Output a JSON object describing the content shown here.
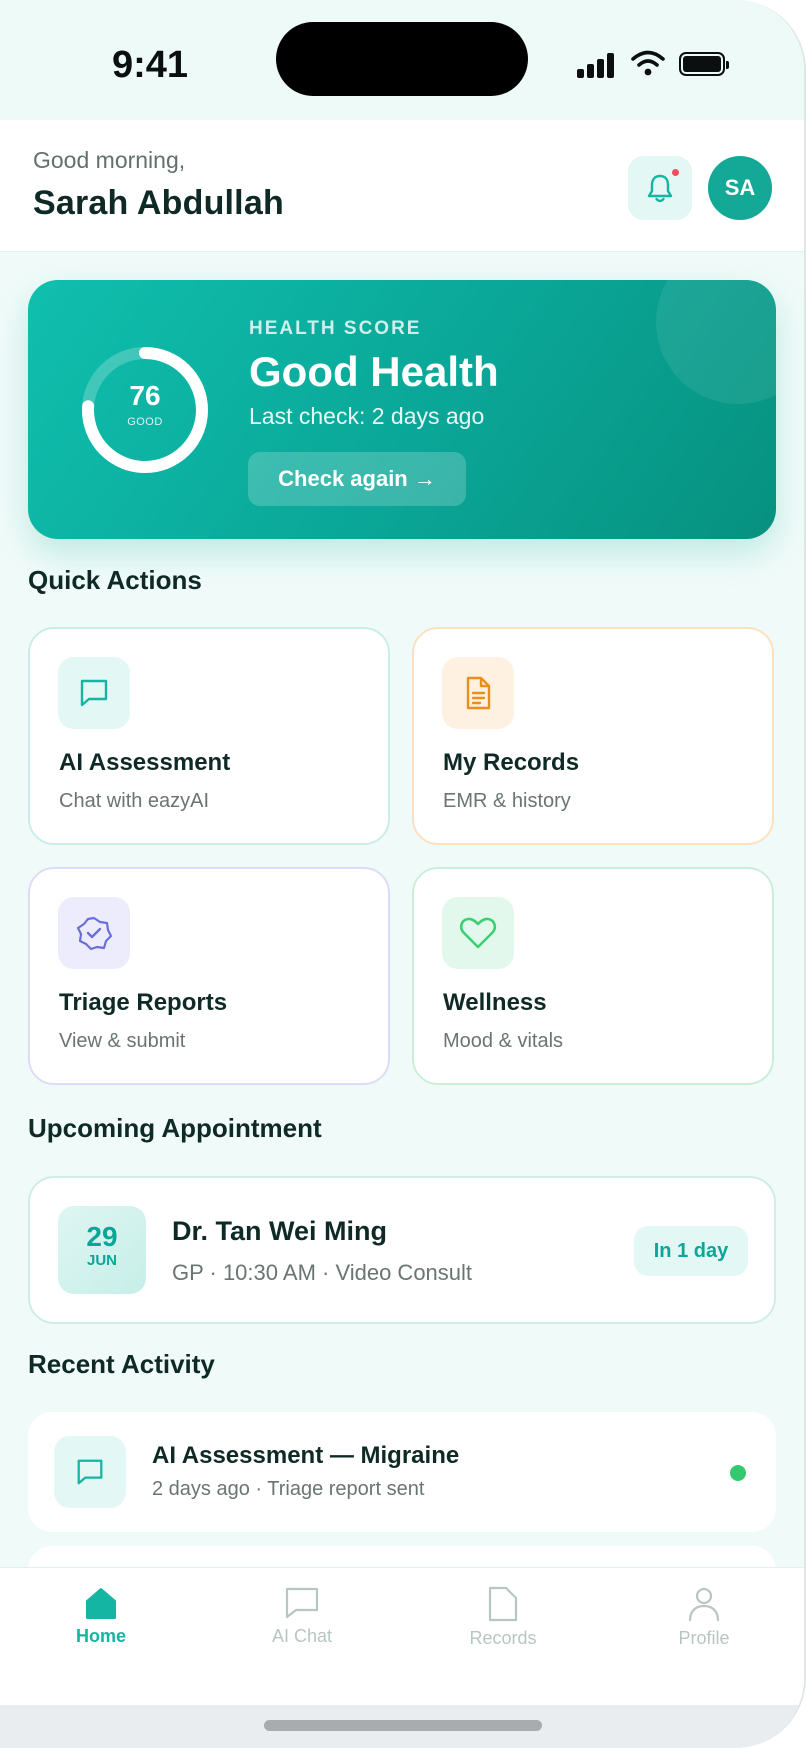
{
  "status_bar": {
    "time": "9:41"
  },
  "header": {
    "greeting": "Good morning,",
    "user_name": "Sarah Abdullah",
    "avatar_initials": "SA",
    "notification_dot": true
  },
  "health_score": {
    "eyebrow": "HEALTH SCORE",
    "score": "76",
    "score_label": "GOOD",
    "score_fraction": 0.76,
    "title": "Good Health",
    "last_check": "Last check: 2 days ago",
    "cta_label": "Check again →"
  },
  "quick_actions": {
    "title": "Quick Actions",
    "items": [
      {
        "title": "AI Assessment",
        "subtitle": "Chat with eazyAI",
        "icon": "chat-icon",
        "accent": "#14b5a3"
      },
      {
        "title": "My Records",
        "subtitle": "EMR & history",
        "icon": "document-icon",
        "accent": "#e8901c"
      },
      {
        "title": "Triage Reports",
        "subtitle": "View & submit",
        "icon": "badge-check-icon",
        "accent": "#6a6fd6"
      },
      {
        "title": "Wellness",
        "subtitle": "Mood & vitals",
        "icon": "heart-icon",
        "accent": "#3ccf73"
      }
    ]
  },
  "appointment": {
    "title": "Upcoming Appointment",
    "day": "29",
    "month": "JUN",
    "doctor": "Dr. Tan Wei Ming",
    "details": "GP · 10:30 AM · Video Consult",
    "badge": "In 1 day"
  },
  "recent_activity": {
    "title": "Recent Activity",
    "items": [
      {
        "title": "AI Assessment — Migraine",
        "meta": "2 days ago · Triage report sent",
        "icon": "chat-icon",
        "status_color": "#35c86f"
      }
    ]
  },
  "bottom_nav": {
    "items": [
      {
        "label": "Home",
        "icon": "home-icon",
        "active": true
      },
      {
        "label": "AI Chat",
        "icon": "chat-icon",
        "active": false
      },
      {
        "label": "Records",
        "icon": "document-icon",
        "active": false
      },
      {
        "label": "Profile",
        "icon": "user-icon",
        "active": false
      }
    ]
  },
  "colors": {
    "brand": "#14b5a3",
    "brand_dark": "#0aa697",
    "alert": "#ef4e5c",
    "text": "#0f2a26",
    "muted": "#6a7573"
  }
}
